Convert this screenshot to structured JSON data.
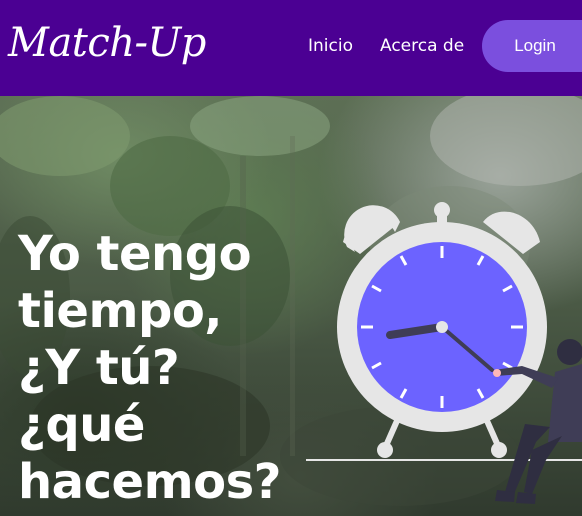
{
  "header": {
    "logo_text": "Match-Up",
    "nav": [
      {
        "label": "Inicio"
      },
      {
        "label": "Acerca de"
      }
    ],
    "login_label": "Login"
  },
  "hero": {
    "headline": "Yo tengo\ntiempo,\n¿Y tú?\n¿qué\nhacemos?"
  },
  "colors": {
    "navbar_bg": "#4b0093",
    "login_bg": "#7b4fde",
    "clock_face": "#6c63ff",
    "clock_ring": "#e6e6e6"
  }
}
